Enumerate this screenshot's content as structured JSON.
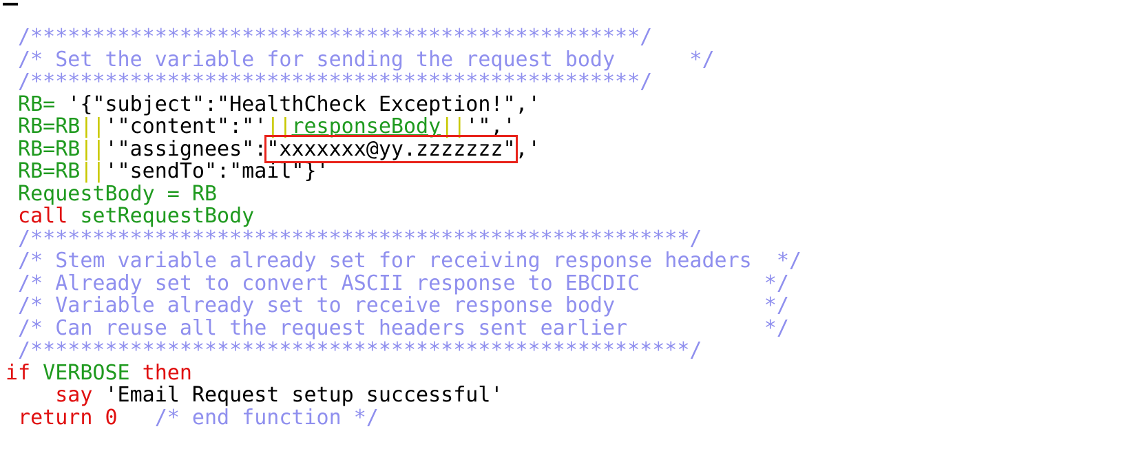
{
  "editor": {
    "lines": [
      [
        {
          "t": " /*************************************************/",
          "c": "comment"
        }
      ],
      [
        {
          "t": " /* Set the variable for sending the request body      */",
          "c": "comment"
        }
      ],
      [
        {
          "t": " /*************************************************/",
          "c": "comment"
        }
      ],
      [
        {
          "t": " RB=",
          "c": "green"
        },
        {
          "t": " '{\"subject\":\"HealthCheck Exception!\",'",
          "c": "black"
        }
      ],
      [
        {
          "t": " RB=RB",
          "c": "green"
        },
        {
          "t": "||",
          "c": "yellow"
        },
        {
          "t": "'\"content\":\"'",
          "c": "black"
        },
        {
          "t": "||",
          "c": "yellow"
        },
        {
          "t": "responseBody",
          "c": "green",
          "u": true
        },
        {
          "t": "||",
          "c": "yellow"
        },
        {
          "t": "'\",'",
          "c": "black"
        }
      ],
      [
        {
          "t": " RB=RB",
          "c": "green"
        },
        {
          "t": "||",
          "c": "yellow"
        },
        {
          "t": "'\"assignees\":",
          "c": "black"
        },
        {
          "t": "\"xxxxxxx@yy.zzzzzzz\"",
          "c": "black",
          "box": true
        },
        {
          "t": ",'",
          "c": "black"
        }
      ],
      [
        {
          "t": " RB=RB",
          "c": "green"
        },
        {
          "t": "||",
          "c": "yellow"
        },
        {
          "t": "'\"sendTo\":\"mail\"}'",
          "c": "black"
        }
      ],
      [
        {
          "t": " RequestBody = RB",
          "c": "green"
        }
      ],
      [
        {
          "t": " call",
          "c": "red"
        },
        {
          "t": " setRequestBody",
          "c": "green"
        }
      ],
      [
        {
          "t": " /*****************************************************/",
          "c": "comment"
        }
      ],
      [
        {
          "t": " /* Stem variable already set for receiving response headers  */",
          "c": "comment"
        }
      ],
      [
        {
          "t": " /* Already set to convert ASCII response to EBCDIC          */",
          "c": "comment"
        }
      ],
      [
        {
          "t": " /* Variable already set to receive response body            */",
          "c": "comment"
        }
      ],
      [
        {
          "t": " /* Can reuse all the request headers sent earlier           */",
          "c": "comment"
        }
      ],
      [
        {
          "t": " /*****************************************************/",
          "c": "comment"
        }
      ],
      [
        {
          "t": "if",
          "c": "red"
        },
        {
          "t": " VERBOSE",
          "c": "green"
        },
        {
          "t": " then",
          "c": "red"
        }
      ],
      [
        {
          "t": "    say",
          "c": "red"
        },
        {
          "t": " 'Email Request setup successful'",
          "c": "black"
        }
      ],
      [
        {
          "t": " return 0",
          "c": "red"
        },
        {
          "t": "   /* end function */",
          "c": "comment"
        }
      ]
    ]
  }
}
